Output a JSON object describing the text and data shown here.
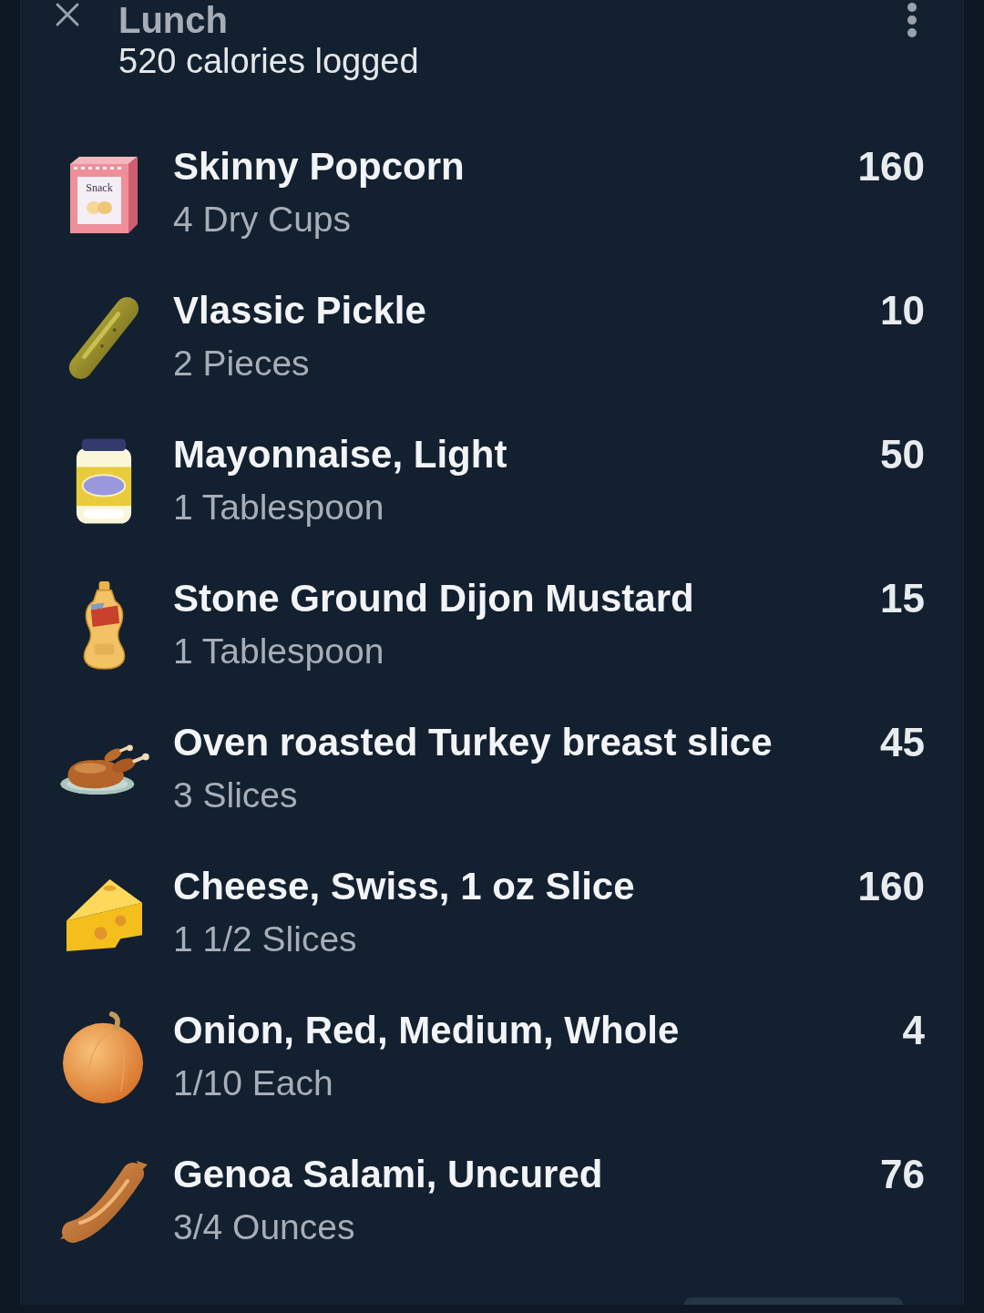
{
  "header": {
    "title": "Lunch",
    "subtitle": "520 calories logged"
  },
  "entries": [
    {
      "name": "Skinny Popcorn",
      "serving": "4 Dry Cups",
      "calories": "160",
      "icon_label": "Snack"
    },
    {
      "name": "Vlassic Pickle",
      "serving": "2 Pieces",
      "calories": "10"
    },
    {
      "name": "Mayonnaise, Light",
      "serving": "1 Tablespoon",
      "calories": "50"
    },
    {
      "name": "Stone Ground Dijon Mustard",
      "serving": "1 Tablespoon",
      "calories": "15"
    },
    {
      "name": "Oven roasted Turkey breast slice",
      "serving": "3 Slices",
      "calories": "45"
    },
    {
      "name": "Cheese, Swiss, 1 oz Slice",
      "serving": "1 1/2 Slices",
      "calories": "160"
    },
    {
      "name": "Onion, Red, Medium, Whole",
      "serving": "1/10 Each",
      "calories": "4"
    },
    {
      "name": "Genoa Salami, Uncured",
      "serving": "3/4 Ounces",
      "calories": "76"
    }
  ]
}
